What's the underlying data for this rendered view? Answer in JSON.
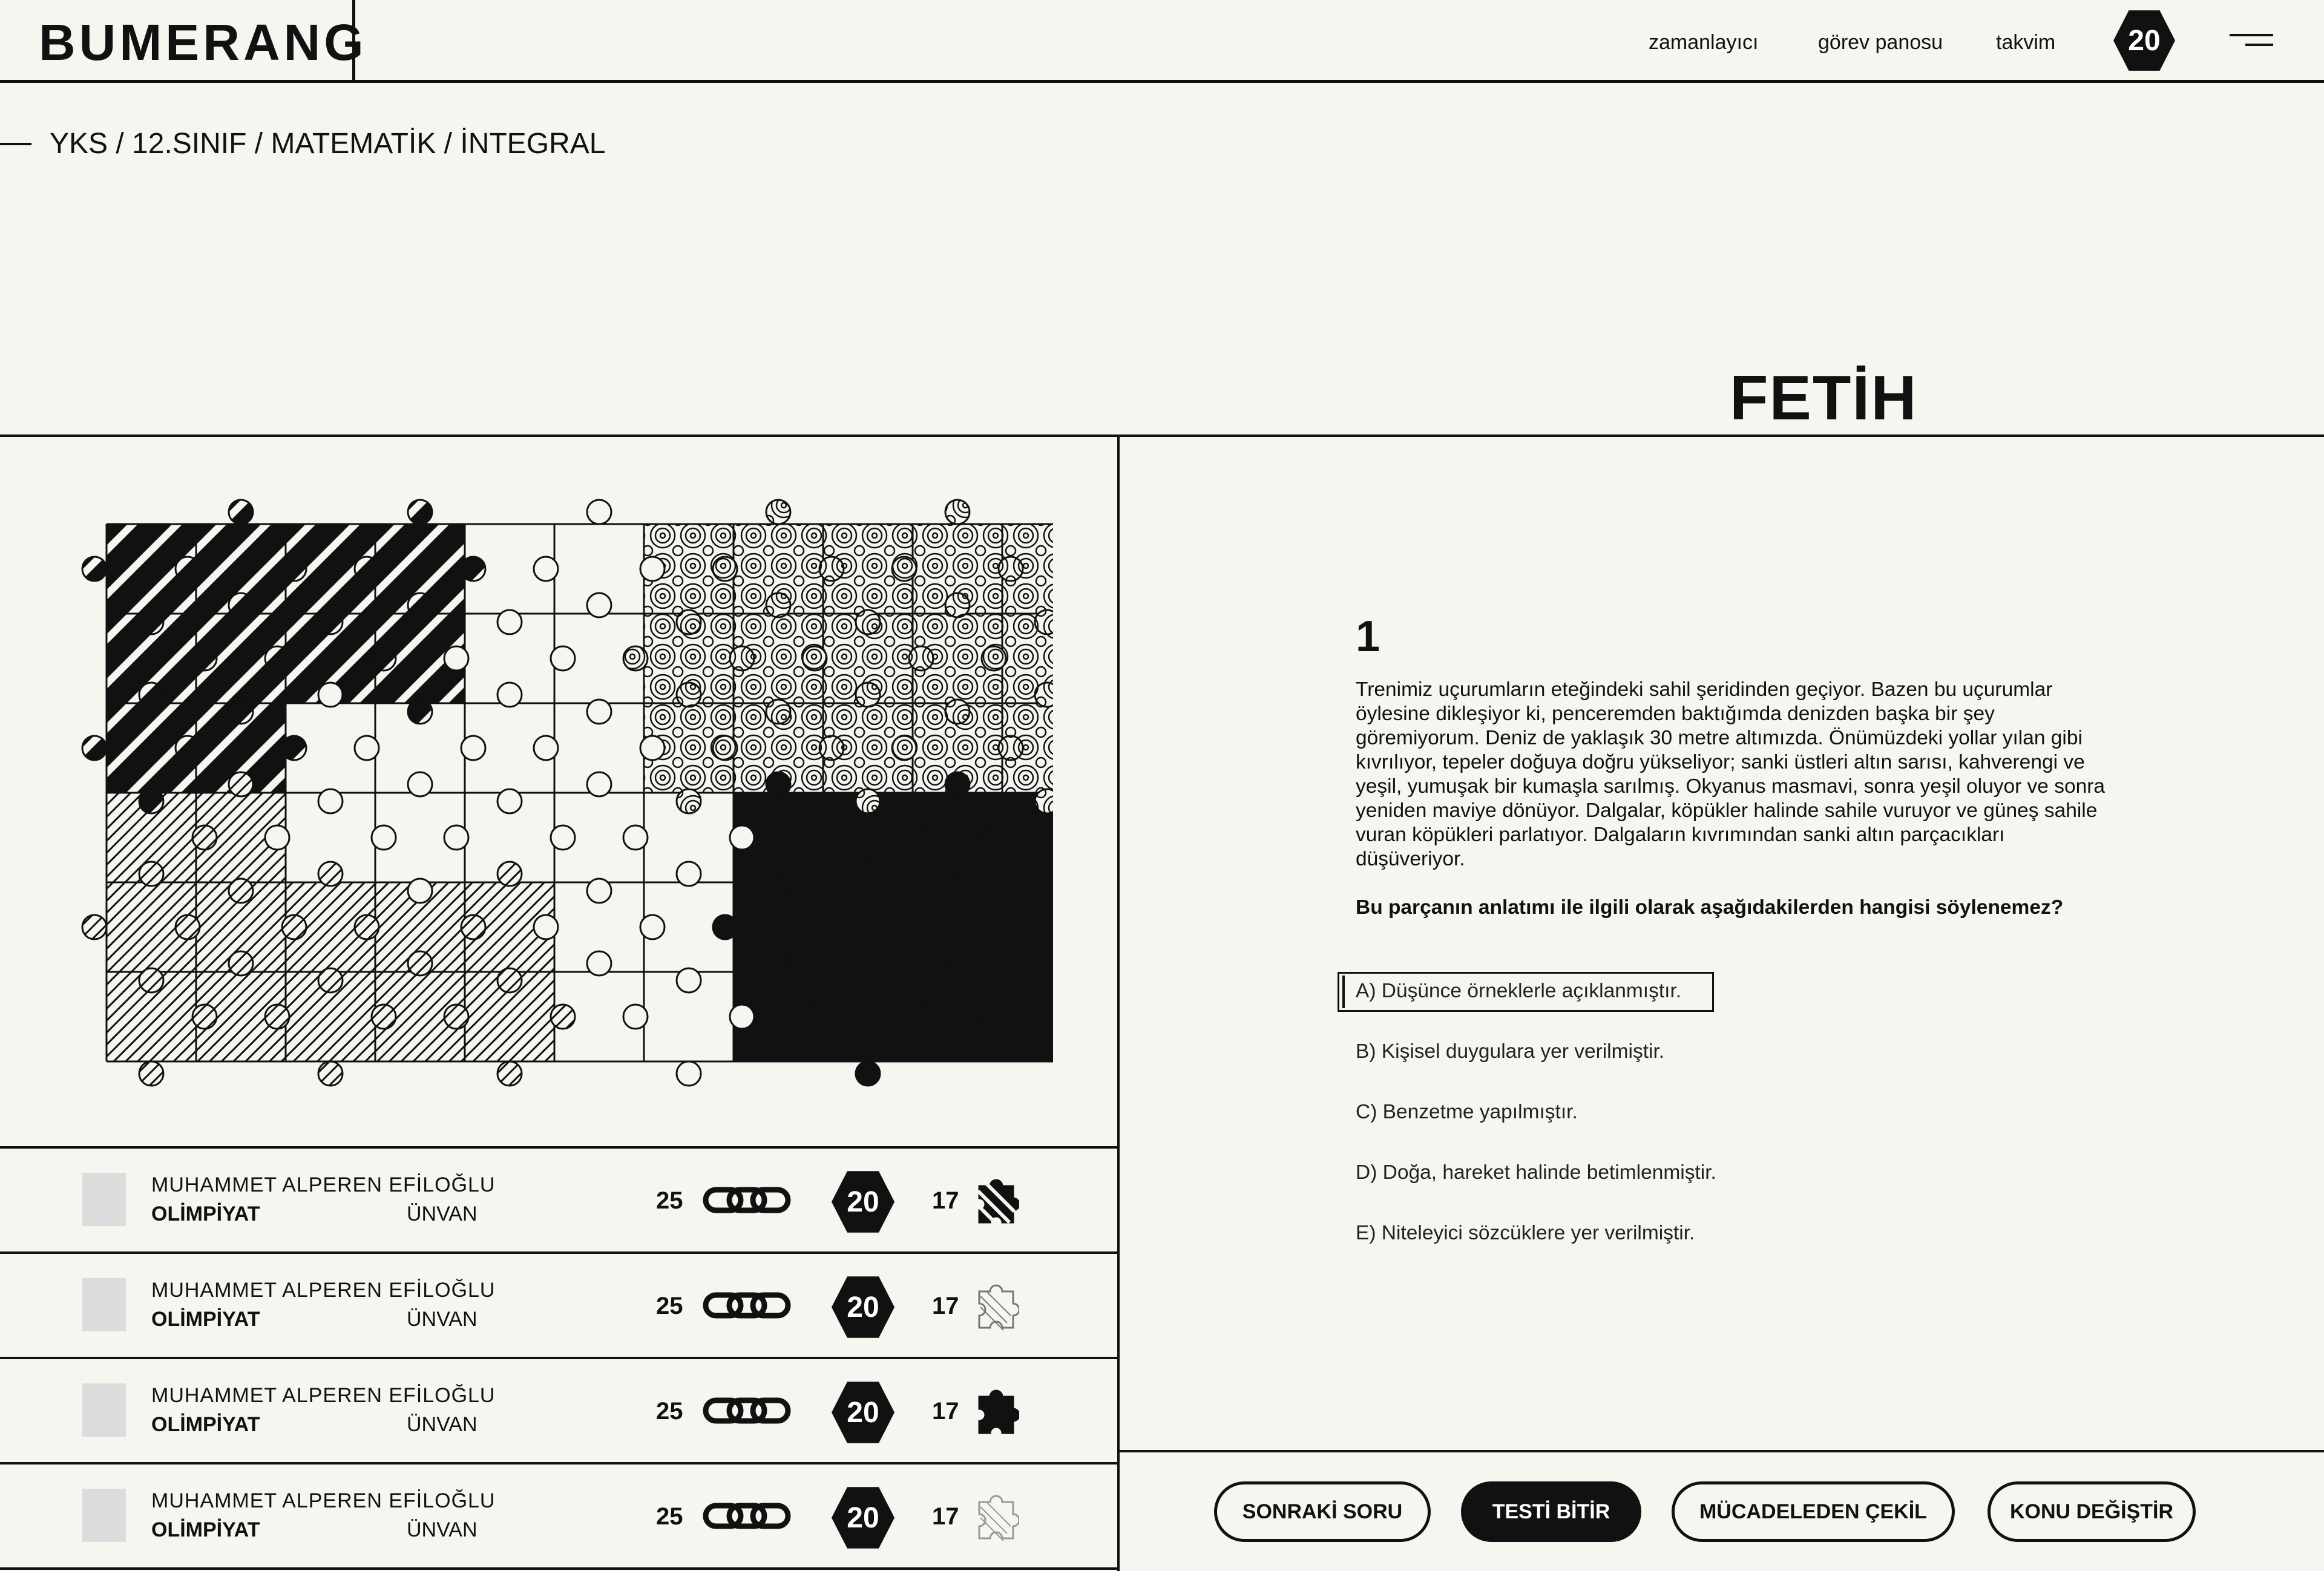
{
  "header": {
    "logo": "BUMERANG",
    "nav": [
      "zamanlayıcı",
      "görev panosu",
      "takvim"
    ],
    "badge": "20",
    "menu_icon": "hamburger-icon"
  },
  "breadcrumb": "YKS / 12.SINIF / MATEMATİK / İNTEGRAL",
  "page_title": "FETİH",
  "leaderboard": [
    {
      "name": "MUHAMMET ALPEREN EFİLOĞLU",
      "level": "OLİMPİYAT",
      "title": "ÜNVAN",
      "score": "25",
      "badge": "20",
      "pieces": "17",
      "piece_style": "black-stripes"
    },
    {
      "name": "MUHAMMET ALPEREN EFİLOĞLU",
      "level": "OLİMPİYAT",
      "title": "ÜNVAN",
      "score": "25",
      "badge": "20",
      "pieces": "17",
      "piece_style": "light-hatch"
    },
    {
      "name": "MUHAMMET ALPEREN EFİLOĞLU",
      "level": "OLİMPİYAT",
      "title": "ÜNVAN",
      "score": "25",
      "badge": "20",
      "pieces": "17",
      "piece_style": "solid-black"
    },
    {
      "name": "MUHAMMET ALPEREN EFİLOĞLU",
      "level": "OLİMPİYAT",
      "title": "ÜNVAN",
      "score": "25",
      "badge": "20",
      "pieces": "17",
      "piece_style": "light-ornament"
    }
  ],
  "question": {
    "number": "1",
    "text": "Trenimiz uçurumların eteğindeki sahil şeridinden geçiyor. Bazen bu uçurumlar öylesine dikleşiyor ki, penceremden baktığımda denizden başka bir şey göremiyorum. Deniz de yaklaşık 30 metre altımızda. Önümüzdeki yollar yılan gibi kıvrılıyor, tepeler doğuya doğru yükseliyor; sanki üstleri altın sarısı, kahverengi ve yeşil, yumuşak bir kumaşla sarılmış. Okyanus masmavi, sonra yeşil oluyor ve sonra yeniden maviye dönüyor. Dalgalar, köpükler halinde sahile vuruyor ve güneş sahile vuran köpükleri parlatıyor. Dalgaların kıvrımından sanki altın parçacıkları düşüveriyor.",
    "prompt": "Bu parçanın anlatımı ile ilgili olarak aşağıdakilerden hangisi söylenemez?",
    "options": [
      "A) Düşünce örneklerle açıklanmıştır.",
      "B) Kişisel duygulara yer verilmiştir.",
      "C) Benzetme yapılmıştır.",
      "D) Doğa, hareket halinde betimlenmiştir.",
      "E) Niteleyici sözcüklere yer verilmiştir."
    ],
    "selected_option": 0
  },
  "actions": {
    "next": "SONRAKİ SORU",
    "finish": "TESTİ BİTİR",
    "withdraw": "MÜCADELEDEN ÇEKİL",
    "change_topic": "KONU DEĞİŞTİR"
  },
  "colors": {
    "background": "#f7f5f0",
    "ink": "#111111",
    "avatar_placeholder": "#dcdcdc"
  }
}
